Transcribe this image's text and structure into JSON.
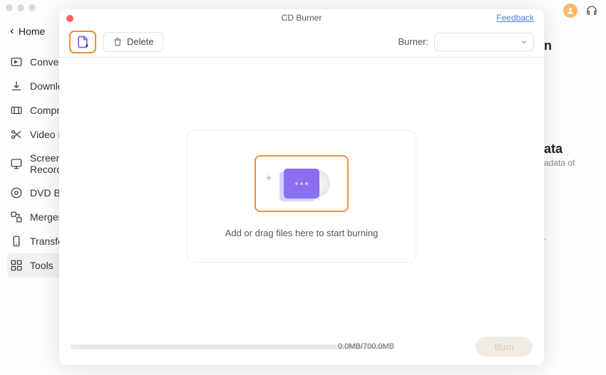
{
  "header": {
    "back_label": "Home"
  },
  "sidebar": {
    "items": [
      {
        "label": "Converter"
      },
      {
        "label": "Downloader"
      },
      {
        "label": "Compressor"
      },
      {
        "label": "Video Editor"
      },
      {
        "label": "Screen Recorder"
      },
      {
        "label": "DVD Burner"
      },
      {
        "label": "Merger"
      },
      {
        "label": "Transfer"
      },
      {
        "label": "Tools"
      }
    ]
  },
  "background_fragments": {
    "line1": "n",
    "line2": "ata",
    "line3": "adata of",
    "line4": "."
  },
  "modal": {
    "title": "CD Burner",
    "feedback": "Feedback",
    "delete_label": "Delete",
    "burner_label": "Burner:",
    "drop_text": "Add or drag files here to start burning",
    "size_text": "0.0MB/700.0MB",
    "burn_label": "Burn"
  }
}
